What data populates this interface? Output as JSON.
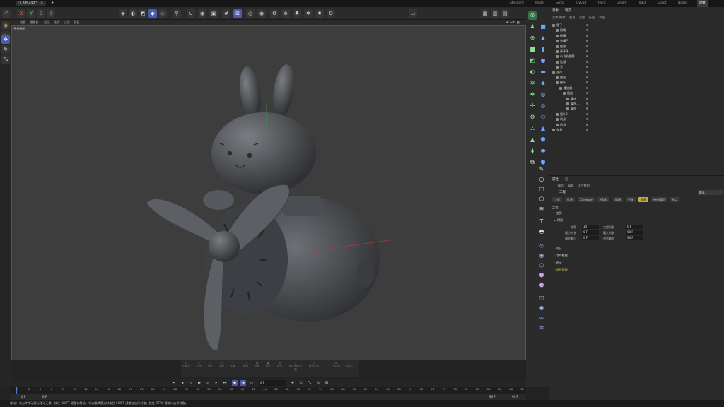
{
  "title_bar": {
    "file_tab": "小飞机.c4d *",
    "close_glyph": "×",
    "add_glyph": "+",
    "layouts": [
      "Standard",
      "Model",
      "Script",
      "UVEdit",
      "Paint",
      "Groom",
      "Track",
      "Script",
      "Nodes",
      "建模"
    ]
  },
  "toolbar": {
    "axes": [
      "X",
      "Y",
      "Z"
    ]
  },
  "viewport_menu": [
    "查看",
    "摄像机",
    "显示",
    "选项",
    "过滤",
    "面板"
  ],
  "viewport": {
    "label": "平行视图",
    "axis_colors": {
      "x": "#d04040",
      "y": "#40c040",
      "z": "#4060d0"
    }
  },
  "bottom_tools": [
    "边缘选",
    "挤压",
    "挤压",
    "坐标",
    "平滑",
    "倒角",
    "桥接",
    "嵌入",
    "挤出",
    "对称",
    "循环/路径切割",
    "线性切割",
    "多边形",
    "多边形"
  ],
  "playback": {
    "frame_display": "0 F",
    "timeline_ticks": [
      "0",
      "2",
      "4",
      "6",
      "8",
      "10",
      "12",
      "14",
      "16",
      "18",
      "20",
      "22",
      "24",
      "26",
      "28",
      "30",
      "32",
      "34",
      "36",
      "38",
      "40",
      "42",
      "44",
      "46",
      "48",
      "50",
      "52",
      "54",
      "56",
      "58",
      "60",
      "62",
      "64",
      "66",
      "68",
      "70",
      "72",
      "74",
      "76",
      "78",
      "80",
      "82",
      "84",
      "86",
      "88",
      "90"
    ],
    "range_start": "0 F",
    "range_start2": "0 F",
    "range_end": "90 F",
    "range_end2": "90 F"
  },
  "status_bar": "移动：点击并拖动鼠标移动元素。按住 SHIFT 键量化移动；节点编辑模式时按住 SHIFT 键增加选择对象；按住 CTRL 键减少选择对象。",
  "object_manager": {
    "tabs": [
      "对象",
      "场次"
    ],
    "menu": [
      "文件",
      "编辑",
      "查看",
      "对象",
      "标签",
      "书签"
    ],
    "rows": [
      "兔子",
      "眼睛",
      "眼睛",
      "兔嘴巴",
      "兔腮",
      "鼻子球",
      "小飞机翅膀",
      "脸颊",
      "头",
      "身体",
      "圆柱",
      "细叶",
      "螺旋桨",
      "扭曲",
      "桨叶",
      "桨叶.1",
      "桨叶",
      "细叶2",
      "机身",
      "机身",
      "车身"
    ]
  },
  "attribute_manager": {
    "tabs": [
      "属性",
      "层"
    ],
    "menu": [
      "模式",
      "编辑",
      "用户数据"
    ],
    "section_title": "工程",
    "preset": "默认",
    "chips": [
      "工程",
      "信息",
      "Cineware",
      "XRefs",
      "动画",
      "子弹",
      "帧率",
      "待办事项",
      "节点"
    ],
    "active_chip": "帧率",
    "group_title": "工程",
    "sections": [
      "比例",
      "时间",
      "执行",
      "用户数据",
      "显示",
      "颜色管理"
    ],
    "fields": [
      {
        "label": "帧率",
        "value": "30"
      },
      {
        "label": "工程时长",
        "value": "0 F"
      },
      {
        "label": "最小时长",
        "value": "0 F"
      },
      {
        "label": "最大时长",
        "value": "90 F"
      },
      {
        "label": "预览最小",
        "value": "0 F"
      },
      {
        "label": "预览最大",
        "value": "90 F"
      }
    ]
  }
}
